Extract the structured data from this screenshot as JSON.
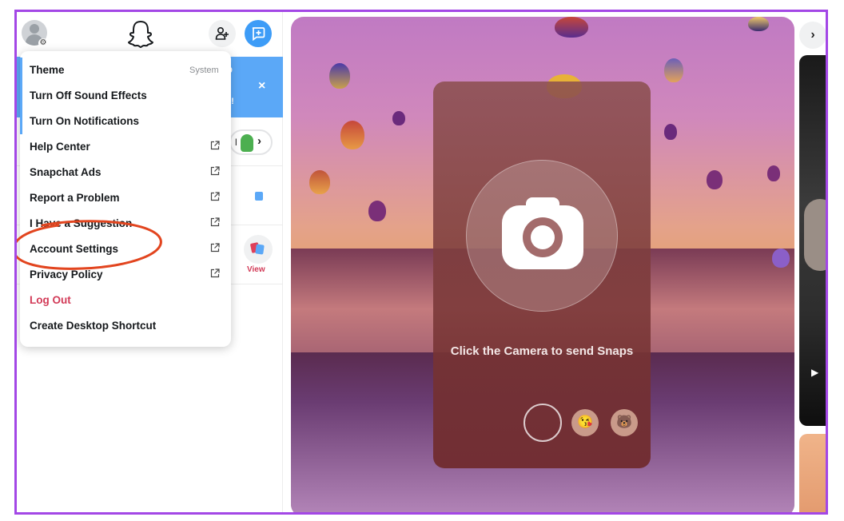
{
  "menu": {
    "items": [
      {
        "label": "Theme",
        "value": "System",
        "external": false
      },
      {
        "label": "Turn Off Sound Effects",
        "external": false
      },
      {
        "label": "Turn On Notifications",
        "external": false
      },
      {
        "label": "Help Center",
        "external": true
      },
      {
        "label": "Snapchat Ads",
        "external": true
      },
      {
        "label": "Report a Problem",
        "external": true
      },
      {
        "label": "I Have a Suggestion",
        "external": true
      },
      {
        "label": "Account Settings",
        "external": true
      },
      {
        "label": "Privacy Policy",
        "external": true
      },
      {
        "label": "Log Out",
        "external": false,
        "style": "danger"
      },
      {
        "label": "Create Desktop Shortcut",
        "external": false
      }
    ]
  },
  "sidebar": {
    "banner_text_fragment_1": "p",
    "banner_text_fragment_2": "s!",
    "banner_close": "×",
    "pill_number": "l",
    "view_label": "View"
  },
  "camera": {
    "prompt": "Click the Camera to send Snaps"
  },
  "icons": {
    "avatar": "avatar-icon",
    "settings_badge": "gear-icon",
    "logo": "snapchat-ghost-icon",
    "add_friend": "add-friend-icon",
    "new_chat": "new-chat-icon",
    "external_link": "external-link-icon",
    "camera": "camera-icon",
    "next": "chevron-right-icon"
  },
  "colors": {
    "accent_blue": "#3d9cf7",
    "danger_red": "#d23a57",
    "frame_purple": "#a347e6",
    "annotation_red": "#e2451f"
  }
}
